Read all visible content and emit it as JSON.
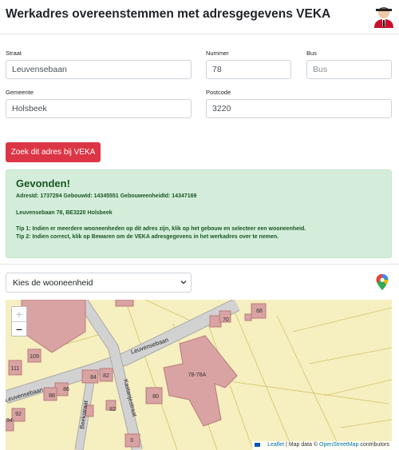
{
  "header": {
    "title": "Werkadres overeenstemmen met adresgegevens VEKA",
    "avatar_icon": "user-avatar-icon"
  },
  "form": {
    "straat_label": "Straat",
    "straat_value": "Leuvensebaan",
    "nummer_label": "Nummer",
    "nummer_value": "78",
    "bus_label": "Bus",
    "bus_placeholder": "Bus",
    "gemeente_label": "Gemeente",
    "gemeente_value": "Holsbeek",
    "postcode_label": "Postcode",
    "postcode_value": "3220"
  },
  "search_button": "Zoek dit adres bij VEKA",
  "result": {
    "title": "Gevonden!",
    "ids_line": "AdresId: 1737294  GebouwId: 14345551  GebouweenheidId: 14347169",
    "address_line": "Leuvensebaan 78, BE3220 Holsbeek",
    "tip1": "Tip 1: Indien er meerdere wooneenheden op dit adres zijn, klik op het gebouw en selecteer een wooneenheid.",
    "tip2": "Tip 2: Indien correct, klik op Bewaren om de VEKA adresgegevens in het werkadres over te nemen."
  },
  "unit_select": {
    "selected": "Kies de wooneenheid"
  },
  "map": {
    "zoom_in": "+",
    "zoom_out": "−",
    "street_labels": [
      "Leuvensebaan",
      "Leuvensebaan",
      "Beekstraat",
      "Kastanjestraat"
    ],
    "house_numbers": [
      "70",
      "68",
      "78-78A",
      "109",
      "111",
      "84",
      "82",
      "86",
      "88",
      "80",
      "82",
      "92",
      "94",
      "3"
    ],
    "attribution": {
      "leaflet": "Leaflet",
      "sep": " | Map data © ",
      "osm": "OpenStreetMap",
      "suffix": " contributors"
    }
  },
  "colors": {
    "danger": "#dc3545",
    "success_bg": "#d4edda",
    "success_text": "#155724",
    "map_bg": "#f6efc0",
    "building": "#d9a3a3",
    "building_stroke": "#b97a7a",
    "road": "#c9c9c9"
  }
}
